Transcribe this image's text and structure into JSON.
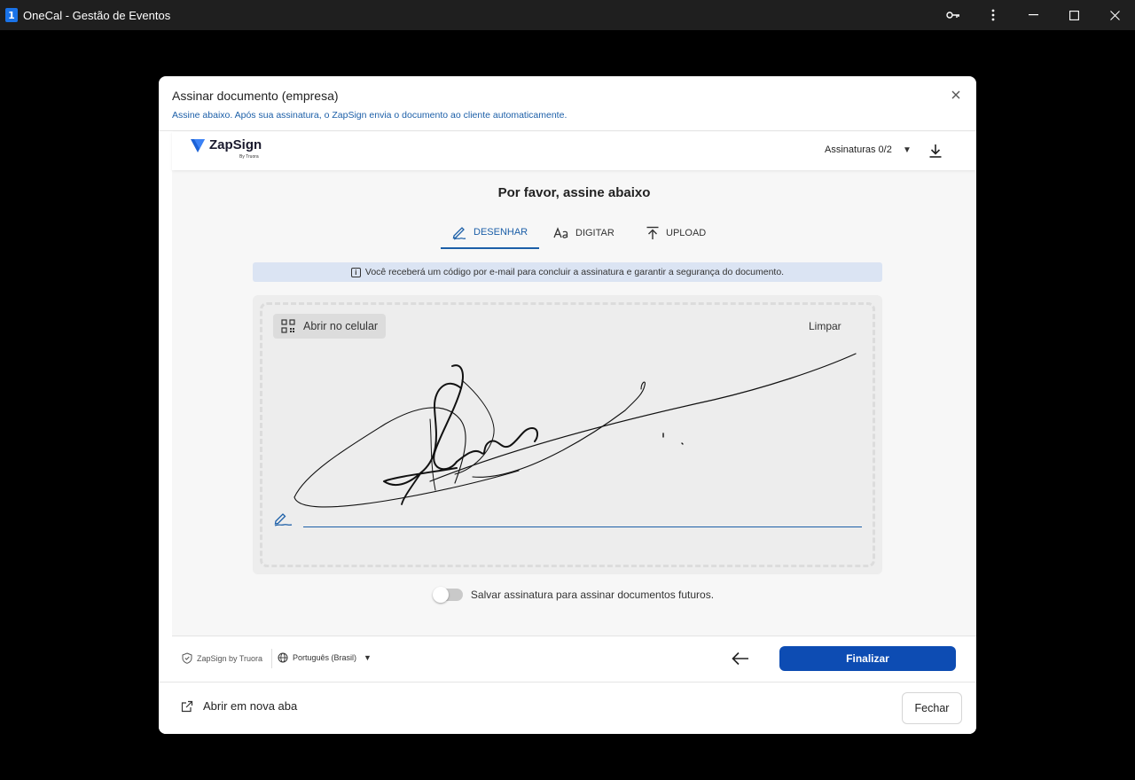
{
  "window": {
    "app_icon_label": "1",
    "title": "OneCal - Gestão de Eventos",
    "controls": [
      "key-icon",
      "more-icon",
      "minimize-icon",
      "maximize-icon",
      "close-icon"
    ]
  },
  "modal": {
    "title": "Assinar documento (empresa)",
    "subtitle": "Assine abaixo. Após sua assinatura, o ZapSign envia o documento ao cliente automaticamente.",
    "close_icon": "close-icon"
  },
  "zapsign": {
    "logo_text": "ZapSign",
    "logo_by": "By Truora",
    "signatures_label": "Assinaturas 0/2",
    "download_icon": "download-icon",
    "heading": "Por favor, assine abaixo",
    "tabs": [
      {
        "label": "DESENHAR",
        "icon": "pen-icon",
        "active": true
      },
      {
        "label": "DIGITAR",
        "icon": "text-icon",
        "active": false
      },
      {
        "label": "UPLOAD",
        "icon": "upload-icon",
        "active": false
      }
    ],
    "info_text": "Você receberá um código por e-mail para concluir a assinatura e garantir a segurança do documento.",
    "open_mobile_label": "Abrir no celular",
    "clear_label": "Limpar",
    "save_signature_label": "Salvar assinatura para assinar documentos futuros.",
    "save_signature_on": false,
    "brand_footer": "ZapSign by Truora",
    "language": "Português (Brasil)",
    "finish_label": "Finalizar",
    "accent_color": "#0d4cb3"
  },
  "footer": {
    "open_new_tab_label": "Abrir em nova aba",
    "close_label": "Fechar"
  }
}
